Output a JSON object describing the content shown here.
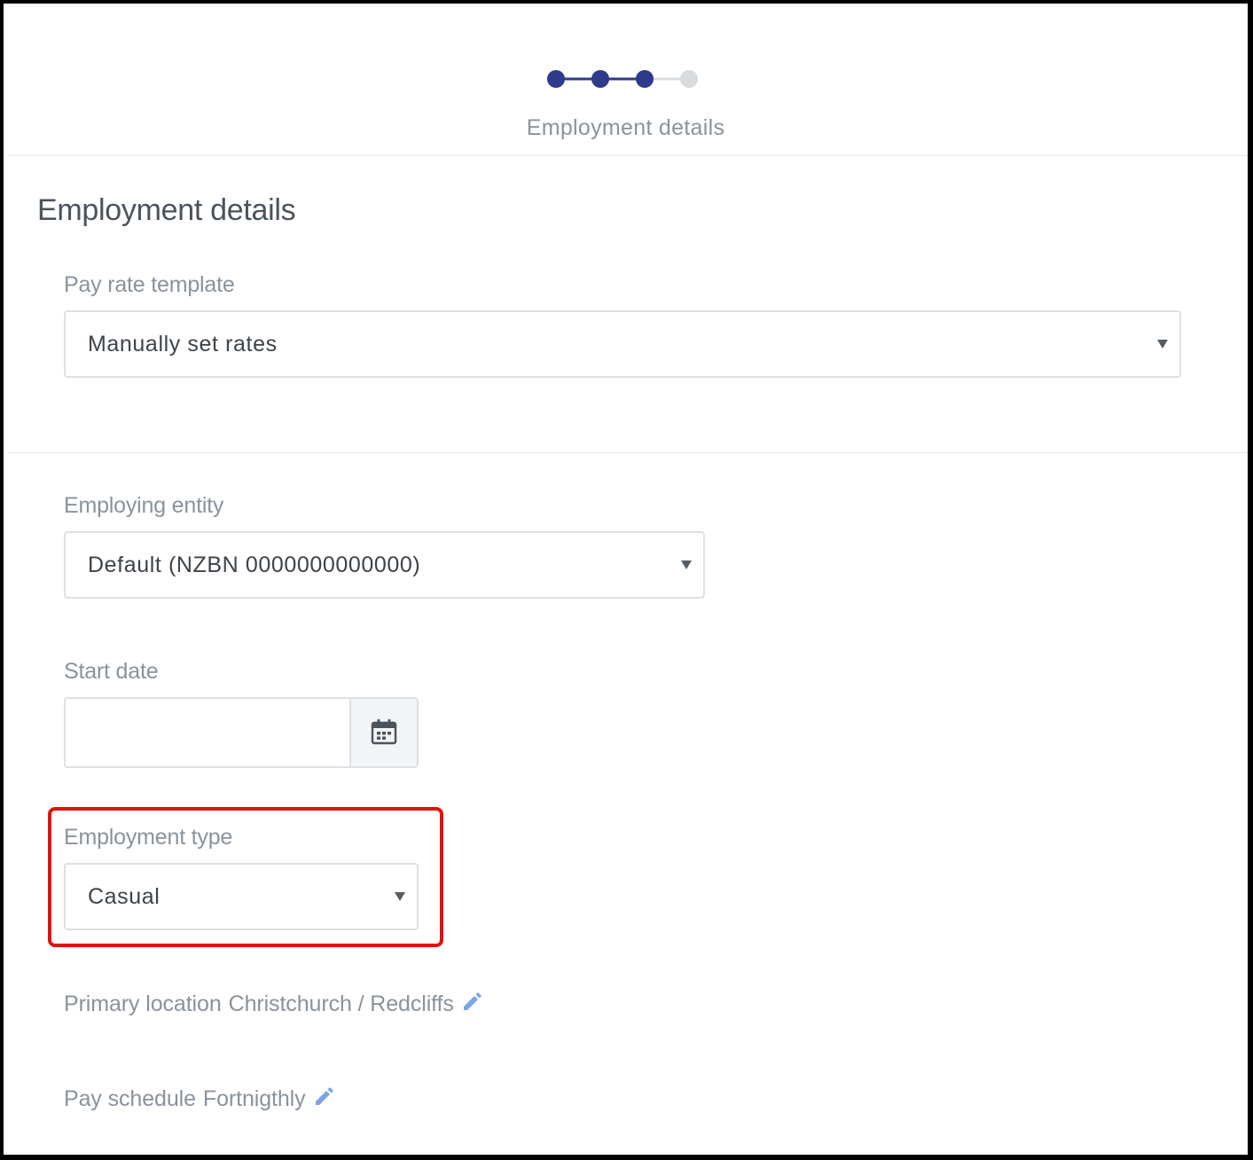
{
  "stepper": {
    "label": "Employment details",
    "total_steps": 4,
    "completed_steps": 3,
    "active_color": "#2e3a8c",
    "inactive_color": "#d9dcdf"
  },
  "section": {
    "title": "Employment details"
  },
  "pay_rate_template": {
    "label": "Pay rate template",
    "value": "Manually set rates"
  },
  "employing_entity": {
    "label": "Employing entity",
    "value": "Default (NZBN 0000000000000)"
  },
  "start_date": {
    "label": "Start date",
    "value": ""
  },
  "employment_type": {
    "label": "Employment type",
    "value": "Casual",
    "highlight_color": "#e3120b"
  },
  "primary_location": {
    "label": "Primary location",
    "value": "Christchurch / Redcliffs"
  },
  "pay_schedule": {
    "label": "Pay schedule",
    "value": "Fortnigthly"
  },
  "icons": {
    "calendar": "calendar-icon",
    "edit": "pencil-icon",
    "caret": "caret-down-icon"
  },
  "colors": {
    "edit_icon": "#7aa3e8",
    "muted_text": "#8a939c"
  }
}
